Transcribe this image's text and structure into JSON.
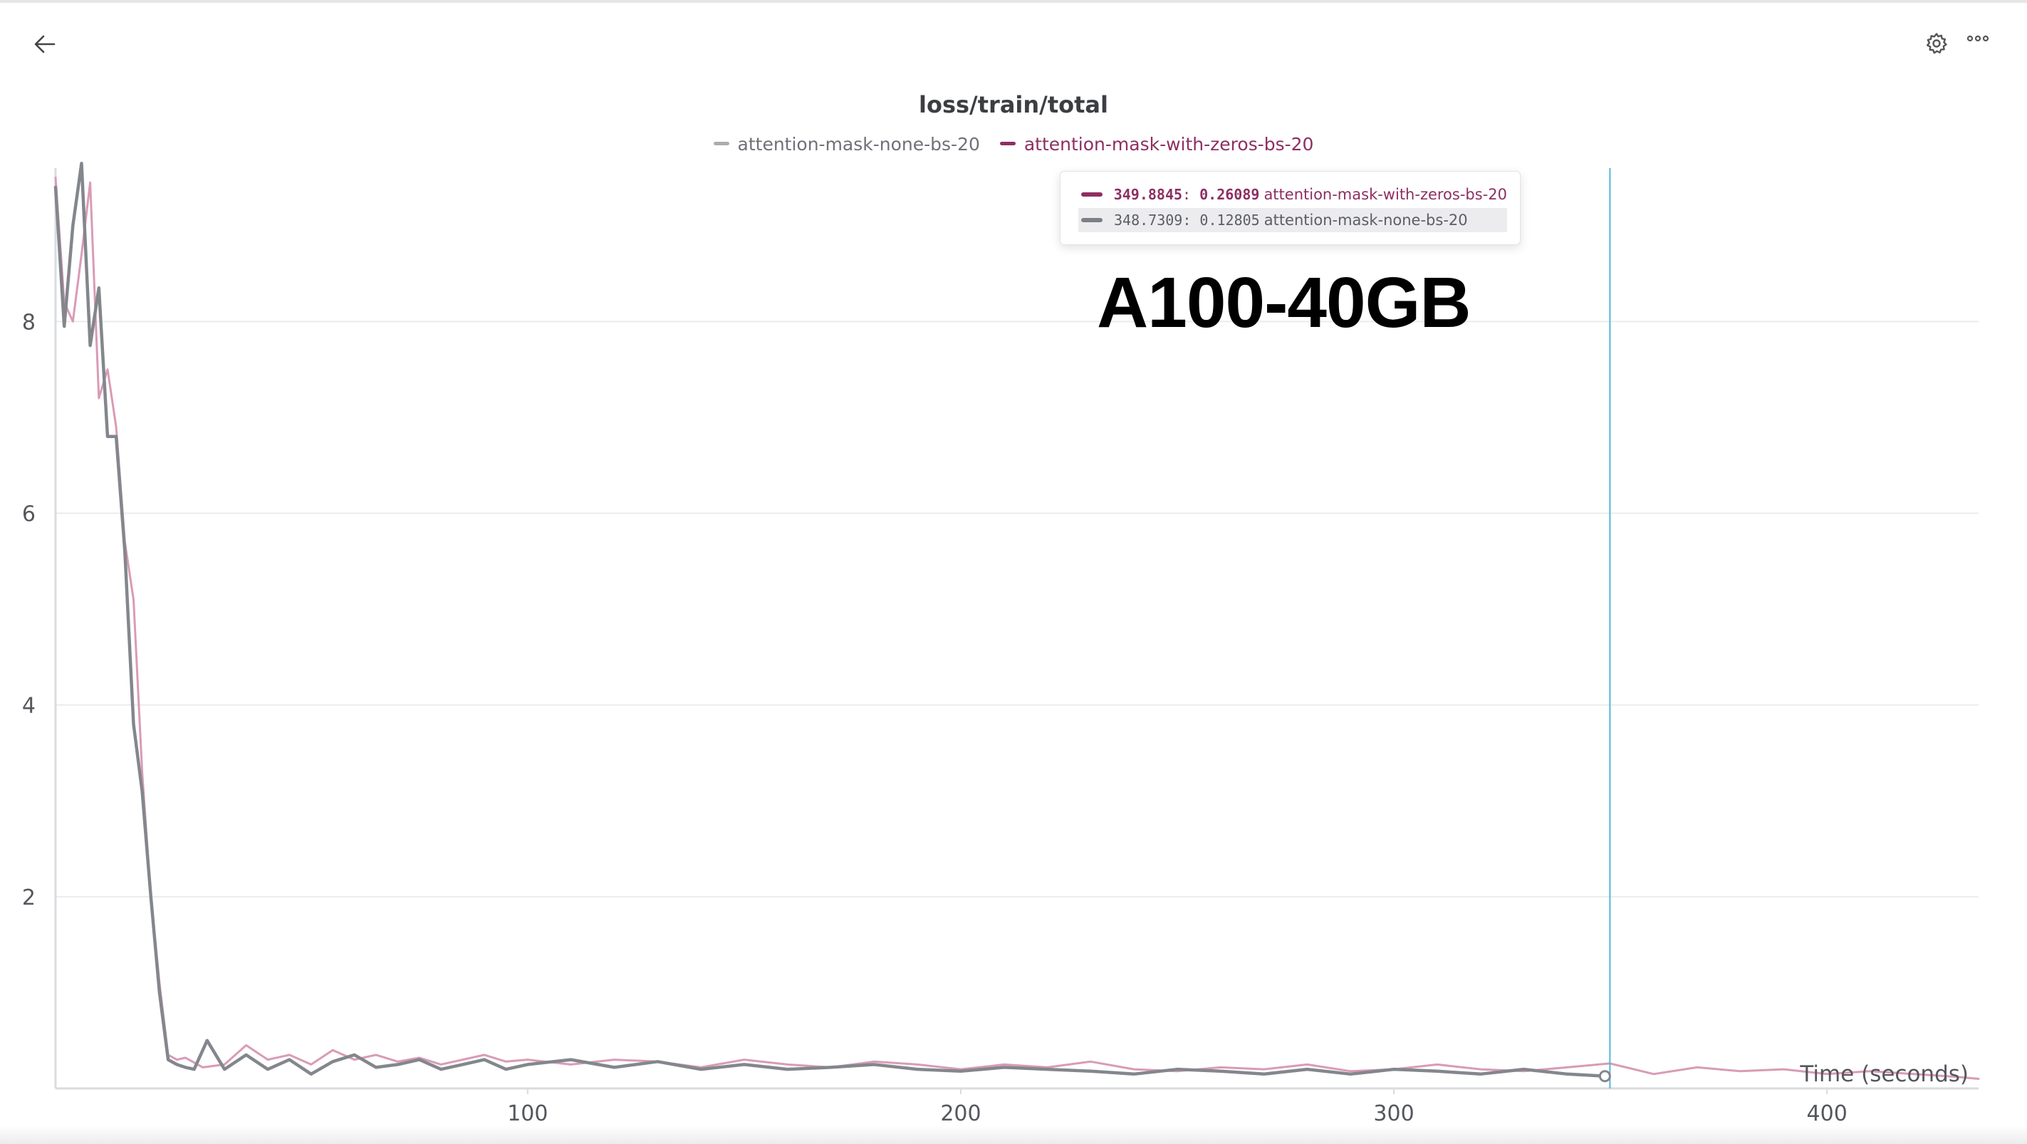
{
  "toolbar": {
    "back_icon": "arrow-left-icon",
    "settings_icon": "gear-icon",
    "more_icon": "more-horizontal-icon"
  },
  "chart_data": {
    "type": "line",
    "title": "loss/train/total",
    "xlabel": "Time (seconds)",
    "ylabel": "",
    "xlim": [
      -9,
      435
    ],
    "ylim": [
      0,
      9.6
    ],
    "xticks": [
      100,
      200,
      300,
      400
    ],
    "yticks": [
      2,
      4,
      6,
      8
    ],
    "grid": true,
    "legend_position": "top-center",
    "series": [
      {
        "name": "attention-mask-none-bs-20",
        "color": "#83878d",
        "x": [
          -9,
          -7,
          -5,
          -3,
          -1,
          1,
          3,
          5,
          7,
          9,
          11,
          13,
          15,
          17,
          19,
          21,
          23,
          26,
          30,
          35,
          40,
          45,
          50,
          55,
          60,
          65,
          70,
          75,
          80,
          85,
          90,
          95,
          100,
          110,
          120,
          130,
          140,
          150,
          160,
          170,
          180,
          190,
          200,
          210,
          220,
          230,
          240,
          250,
          260,
          270,
          280,
          290,
          300,
          310,
          320,
          330,
          340,
          348.7309
        ],
        "y": [
          9.4,
          7.95,
          9.0,
          9.65,
          7.75,
          8.35,
          6.8,
          6.8,
          5.6,
          3.8,
          3.1,
          2.0,
          1.0,
          0.3,
          0.25,
          0.22,
          0.2,
          0.5,
          0.2,
          0.35,
          0.2,
          0.3,
          0.15,
          0.28,
          0.35,
          0.22,
          0.25,
          0.3,
          0.2,
          0.25,
          0.3,
          0.2,
          0.25,
          0.3,
          0.22,
          0.28,
          0.2,
          0.25,
          0.2,
          0.22,
          0.25,
          0.2,
          0.18,
          0.22,
          0.2,
          0.18,
          0.15,
          0.2,
          0.18,
          0.15,
          0.2,
          0.15,
          0.2,
          0.18,
          0.15,
          0.2,
          0.15,
          0.12805
        ]
      },
      {
        "name": "attention-mask-with-zeros-bs-20",
        "color": "#d99bb5",
        "x": [
          -9,
          -7,
          -5,
          -3,
          -1,
          1,
          3,
          5,
          7,
          9,
          11,
          13,
          15,
          17,
          19,
          21,
          25,
          30,
          35,
          40,
          45,
          50,
          55,
          60,
          65,
          70,
          75,
          80,
          85,
          90,
          95,
          100,
          110,
          120,
          130,
          140,
          150,
          160,
          170,
          180,
          190,
          200,
          210,
          220,
          230,
          240,
          250,
          260,
          270,
          280,
          290,
          300,
          310,
          320,
          330,
          340,
          349.8845,
          360,
          370,
          380,
          390,
          400,
          410,
          420,
          430,
          435
        ],
        "y": [
          9.5,
          8.2,
          8.0,
          8.7,
          9.45,
          7.2,
          7.5,
          6.9,
          5.7,
          5.1,
          3.3,
          2.0,
          1.1,
          0.35,
          0.3,
          0.32,
          0.22,
          0.25,
          0.45,
          0.3,
          0.35,
          0.25,
          0.4,
          0.3,
          0.35,
          0.28,
          0.32,
          0.25,
          0.3,
          0.35,
          0.28,
          0.3,
          0.25,
          0.3,
          0.28,
          0.22,
          0.3,
          0.25,
          0.22,
          0.28,
          0.25,
          0.2,
          0.25,
          0.22,
          0.28,
          0.2,
          0.18,
          0.22,
          0.2,
          0.25,
          0.18,
          0.2,
          0.25,
          0.2,
          0.18,
          0.22,
          0.26089,
          0.15,
          0.22,
          0.18,
          0.2,
          0.15,
          0.18,
          0.15,
          0.12,
          0.1
        ]
      }
    ],
    "hover": {
      "rows": [
        {
          "series": "attention-mask-with-zeros-bs-20",
          "x": "349.8845",
          "y": "0.26089",
          "color": "#8e2f62",
          "highlight": false
        },
        {
          "series": "attention-mask-none-bs-20",
          "x": "348.7309",
          "y": "0.12805",
          "color": "#7d8086",
          "highlight": true
        }
      ]
    },
    "annotations": [
      {
        "text": "A100-40GB"
      }
    ],
    "colors": {
      "grid": "#e9ebee",
      "axis": "#d9dbdf",
      "hover_line": "#51b7d8",
      "tick_text": "#54575c"
    }
  }
}
